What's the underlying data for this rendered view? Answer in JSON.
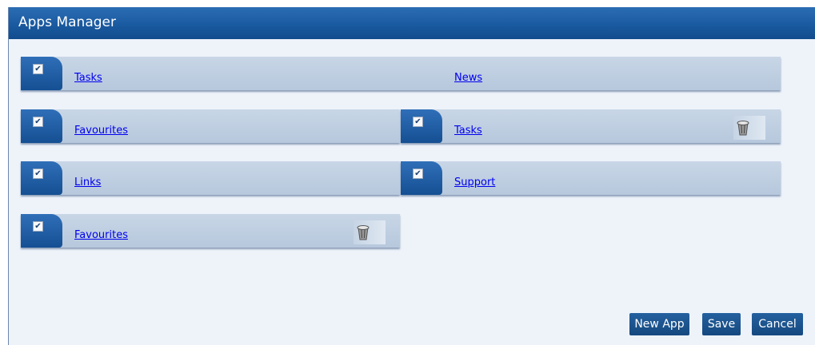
{
  "window": {
    "title": "Apps Manager"
  },
  "apps": {
    "row1_left": {
      "label": "Tasks",
      "checked": true
    },
    "row1_right": {
      "label": "News"
    },
    "row2_left": {
      "label": "Favourites",
      "checked": true
    },
    "row2_right": {
      "label": "Tasks",
      "checked": true,
      "deletable": true
    },
    "row3_left": {
      "label": "Links",
      "checked": true
    },
    "row3_right": {
      "label": "Support",
      "checked": true
    },
    "row4_left": {
      "label": "Favourites",
      "checked": true,
      "deletable": true
    }
  },
  "checkmark": "✔",
  "icons": {
    "delete": "trash-can-icon",
    "check": "checkbox-checked-icon"
  },
  "buttons": {
    "new_app": "New App",
    "save": "Save",
    "cancel": "Cancel"
  },
  "colors": {
    "title_bar": "#1a5aa0",
    "row_bg": "#c0d0e3",
    "link": "#0000ee",
    "panel_bg": "#eef3fa"
  }
}
